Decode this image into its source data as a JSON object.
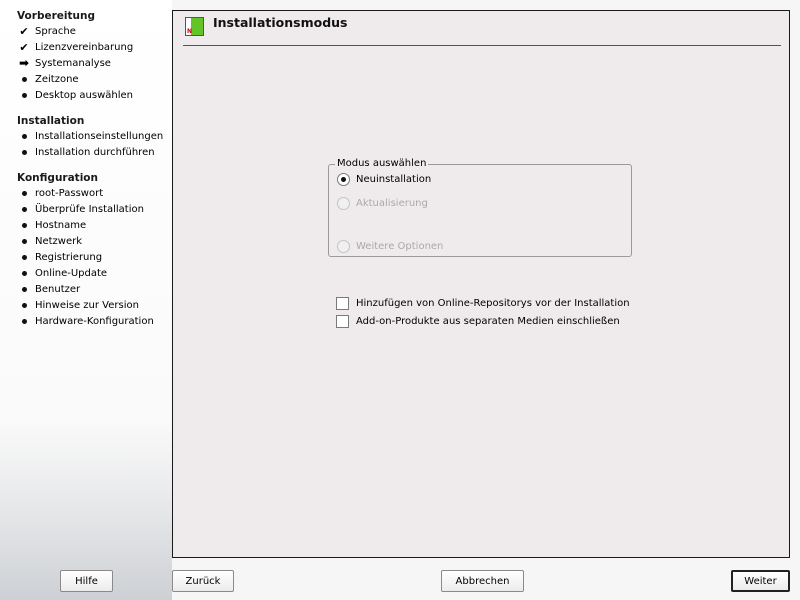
{
  "sidebar": {
    "sections": [
      {
        "title": "Vorbereitung",
        "steps": [
          {
            "label": "Sprache",
            "state": "done"
          },
          {
            "label": "Lizenzvereinbarung",
            "state": "done"
          },
          {
            "label": "Systemanalyse",
            "state": "current"
          },
          {
            "label": "Zeitzone",
            "state": "todo"
          },
          {
            "label": "Desktop auswählen",
            "state": "todo"
          }
        ]
      },
      {
        "title": "Installation",
        "steps": [
          {
            "label": "Installationseinstellungen",
            "state": "todo"
          },
          {
            "label": "Installation durchführen",
            "state": "todo"
          }
        ]
      },
      {
        "title": "Konfiguration",
        "steps": [
          {
            "label": "root-Passwort",
            "state": "todo"
          },
          {
            "label": "Überprüfe Installation",
            "state": "todo"
          },
          {
            "label": "Hostname",
            "state": "todo"
          },
          {
            "label": "Netzwerk",
            "state": "todo"
          },
          {
            "label": "Registrierung",
            "state": "todo"
          },
          {
            "label": "Online-Update",
            "state": "todo"
          },
          {
            "label": "Benutzer",
            "state": "todo"
          },
          {
            "label": "Hinweise zur Version",
            "state": "todo"
          },
          {
            "label": "Hardware-Konfiguration",
            "state": "todo"
          }
        ]
      }
    ]
  },
  "main": {
    "title": "Installationsmodus",
    "mode_group": {
      "legend": "Modus auswählen",
      "options": [
        {
          "label": "Neuinstallation",
          "selected": true,
          "enabled": true
        },
        {
          "label": "Aktualisierung",
          "selected": false,
          "enabled": false
        },
        {
          "label": "Weitere Optionen",
          "selected": false,
          "enabled": false
        }
      ]
    },
    "checkboxes": [
      {
        "label": "Hinzufügen von Online-Repositorys vor der Installation",
        "checked": false
      },
      {
        "label": "Add-on-Produkte aus separaten Medien einschließen",
        "checked": false
      }
    ]
  },
  "buttons": {
    "help": "Hilfe",
    "back": "Zurück",
    "abort": "Abbrechen",
    "next": "Weiter"
  },
  "colors": {
    "icon_green": "#62c427",
    "panel_bg": "#efebec"
  }
}
